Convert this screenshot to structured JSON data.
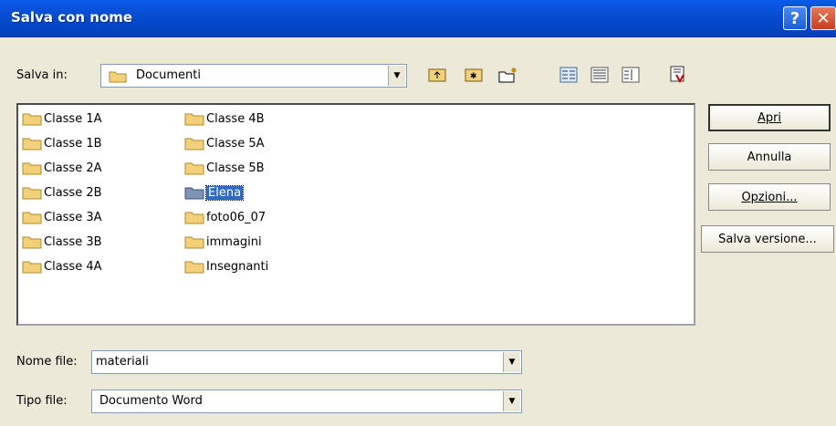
{
  "window": {
    "title": "Salva con nome"
  },
  "save_in": {
    "label": "Salva in:",
    "value": "Documenti"
  },
  "toolbar": [
    {
      "name": "up-folder-icon"
    },
    {
      "name": "desktop-icon"
    },
    {
      "name": "new-folder-icon"
    },
    {
      "name": "list-view-icon"
    },
    {
      "name": "details-view-icon"
    },
    {
      "name": "properties-view-icon"
    },
    {
      "name": "tools-icon"
    }
  ],
  "files": [
    {
      "label": "Classe 1A"
    },
    {
      "label": "Classe 1B"
    },
    {
      "label": "Classe 2A"
    },
    {
      "label": "Classe 2B"
    },
    {
      "label": "Classe 3A"
    },
    {
      "label": "Classe 3B"
    },
    {
      "label": "Classe 4A"
    },
    {
      "label": "Classe 4B"
    },
    {
      "label": "Classe 5A"
    },
    {
      "label": "Classe 5B"
    },
    {
      "label": "Elena"
    },
    {
      "label": "foto06_07"
    },
    {
      "label": "immagini"
    },
    {
      "label": "Insegnanti"
    }
  ],
  "selected_file": "Elena",
  "buttons": {
    "open": "Apri",
    "cancel": "Annulla",
    "options": "Opzioni...",
    "save_version": "Salva versione..."
  },
  "filename": {
    "label": "Nome file:",
    "value": "materiali"
  },
  "filetype": {
    "label": "Tipo file:",
    "value": "Documento Word"
  },
  "colors": {
    "titlebar": "#0A5BEA",
    "selection": "#316AC5",
    "dialog_bg": "#ECE9D8"
  }
}
